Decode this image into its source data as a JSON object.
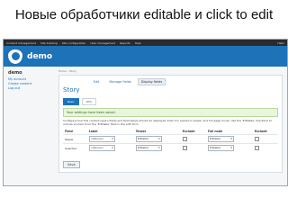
{
  "slide": {
    "title": "Новые обработчики editable и click to edit"
  },
  "admin_bar": {
    "items": [
      "Content management",
      "Site building",
      "Site configuration",
      "User management",
      "Reports",
      "Help"
    ],
    "right": "Hello"
  },
  "site": {
    "name": "demo"
  },
  "sidebar": {
    "title": "demo",
    "links": [
      "My account",
      "Create content",
      "Log out"
    ]
  },
  "breadcrumb": "Home › Story",
  "page": {
    "title": "Story",
    "tabs": [
      "Edit",
      "Manage fields",
      "Display fields"
    ],
    "subtabs": [
      "Basic",
      "RSS"
    ],
    "message": "Your settings have been saved.",
    "description": "Configure how this content type's fields and field labels should be displayed when it's viewed in teaser and full-page mode. Use the 'Editable' checkbox to include an item from the 'Editable' field in the edit form."
  },
  "table": {
    "headers": [
      "Field",
      "Label",
      "Teaser",
      "Exclude",
      "Full node",
      "Exclude"
    ],
    "rows": [
      {
        "field": "Teaser",
        "label": "<Above>",
        "teaser": "Editable",
        "full": "Editable"
      },
      {
        "field": "Selected",
        "label": "<Above>",
        "teaser": "Editable",
        "full": "Editable"
      }
    ]
  },
  "save_label": "Save",
  "colors": {
    "header": "#1d72b8",
    "admin_bar": "#2b2b2b",
    "message_bg": "#e9f5dc"
  }
}
